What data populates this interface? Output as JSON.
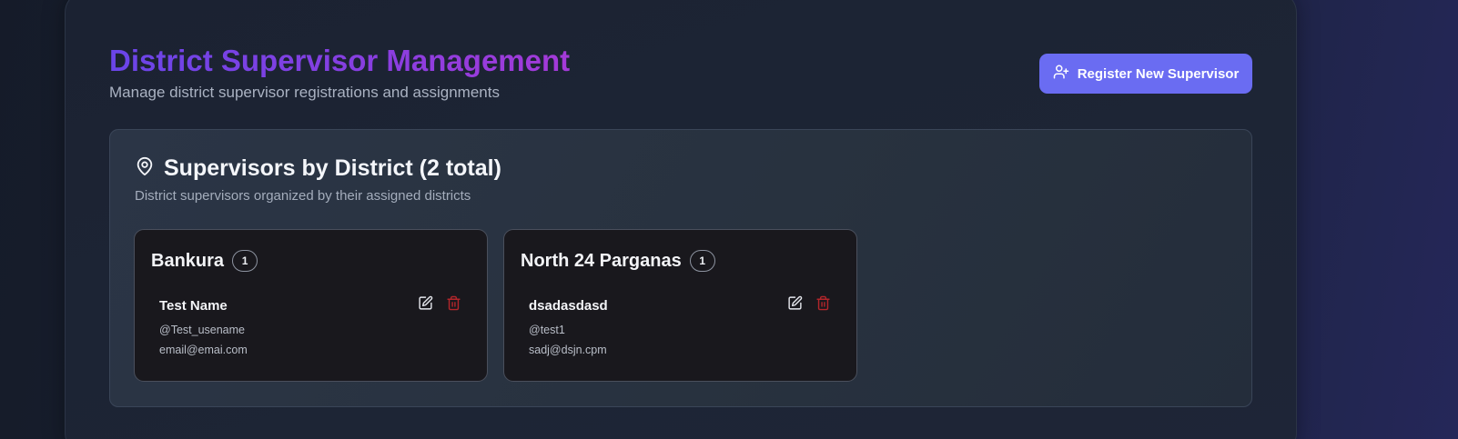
{
  "header": {
    "title": "District Supervisor Management",
    "subtitle": "Manage district supervisor registrations and assignments",
    "register_button_label": "Register New Supervisor"
  },
  "section": {
    "title": "Supervisors by District (2 total)",
    "description": "District supervisors organized by their assigned districts"
  },
  "districts": [
    {
      "name": "Bankura",
      "count": "1",
      "supervisors": [
        {
          "name": "Test Name",
          "username": "@Test_usename",
          "email": "email@emai.com"
        }
      ]
    },
    {
      "name": "North 24 Parganas",
      "count": "1",
      "supervisors": [
        {
          "name": "dsadasdasd",
          "username": "@test1",
          "email": "sadj@dsjn.cpm"
        }
      ]
    }
  ],
  "icons": {
    "register": "user-plus-icon",
    "section": "map-pin-icon",
    "edit": "edit-icon",
    "delete": "trash-icon"
  },
  "colors": {
    "accent": "#6a6cf2",
    "title_gradient_start": "#6a45e8",
    "title_gradient_end": "#a43ad8",
    "delete": "#b3262b"
  }
}
